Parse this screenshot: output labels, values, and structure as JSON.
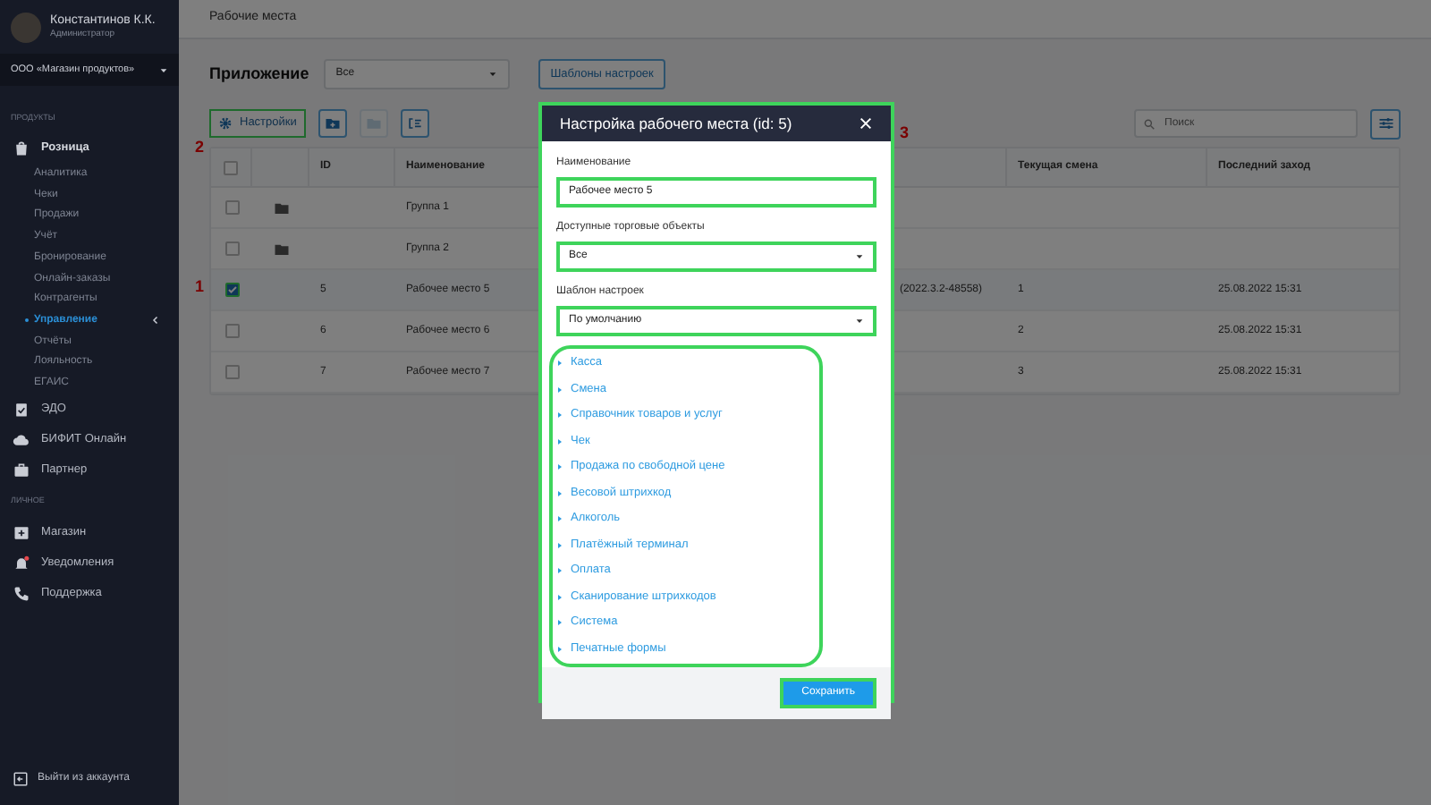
{
  "sidebar": {
    "user": {
      "name": "Константинов К.К.",
      "role": "Администратор"
    },
    "org": "ООО «Магазин продуктов»",
    "sections": [
      {
        "title": "ПРОДУКТЫ",
        "items": [
          {
            "label": "Розница",
            "children": [
              {
                "label": "Аналитика",
                "selected": false
              },
              {
                "label": "Чеки",
                "selected": false
              },
              {
                "label": "Продажи",
                "selected": false
              },
              {
                "label": "Учёт",
                "selected": false
              },
              {
                "label": "Бронирование",
                "selected": false
              },
              {
                "label": "Онлайн-заказы",
                "selected": false
              },
              {
                "label": "Контрагенты",
                "selected": false
              },
              {
                "label": "Управление",
                "selected": true
              },
              {
                "label": "Отчёты",
                "selected": false
              },
              {
                "label": "Лояльность",
                "selected": false
              },
              {
                "label": "ЕГАИС",
                "selected": false
              }
            ]
          },
          {
            "label": "ЭДО"
          },
          {
            "label": "БИФИТ Онлайн"
          },
          {
            "label": "Партнер"
          }
        ]
      },
      {
        "title": "ЛИЧНОЕ",
        "items": [
          {
            "label": "Магазин"
          },
          {
            "label": "Уведомления"
          },
          {
            "label": "Поддержка"
          }
        ]
      }
    ],
    "logout": "Выйти из аккаунта"
  },
  "page_title": "Рабочие места",
  "filter": {
    "label": "Приложение",
    "value": "Все"
  },
  "templates_button": "Шаблоны настроек",
  "toolbar": {
    "settings_button": "Настройки",
    "icon_buttons": [
      {
        "kind": "add-folder",
        "disabled": false
      },
      {
        "kind": "move-folder",
        "disabled": true
      },
      {
        "kind": "list",
        "disabled": false
      }
    ]
  },
  "search": {
    "placeholder": "Поиск"
  },
  "table": {
    "header_checked": false,
    "columns": [
      "ID",
      "Наименование",
      "Текущая смена",
      "Последний заход"
    ],
    "rows": [
      {
        "kind": "group",
        "checked": false,
        "id": "",
        "name": "Группа 1",
        "column_5": "",
        "shift": "",
        "last_login": ""
      },
      {
        "kind": "group",
        "checked": false,
        "id": "",
        "name": "Группа 2",
        "column_5": "",
        "shift": "",
        "last_login": ""
      },
      {
        "kind": "workplace",
        "checked": true,
        "id": "5",
        "name": "Рабочее место 5",
        "column_5": "(2022.3.2-48558)",
        "shift": "1",
        "last_login": "25.08.2022 15:31"
      },
      {
        "kind": "workplace",
        "checked": false,
        "id": "6",
        "name": "Рабочее место 6",
        "column_5": "",
        "shift": "2",
        "last_login": "25.08.2022 15:31"
      },
      {
        "kind": "workplace",
        "checked": false,
        "id": "7",
        "name": "Рабочее место 7",
        "column_5": "",
        "shift": "3",
        "last_login": "25.08.2022 15:31"
      }
    ]
  },
  "annotations": [
    {
      "label": "1"
    },
    {
      "label": "2"
    },
    {
      "label": "3"
    }
  ],
  "dialog": {
    "title": "Настройка рабочего места (id: 5)",
    "fields": [
      {
        "label": "Наименование",
        "kind": "text",
        "value": "Рабочее место 5"
      },
      {
        "label": "Доступные торговые объекты",
        "kind": "select",
        "value": "Все"
      },
      {
        "label": "Шаблон настроек",
        "kind": "select",
        "value": "По умолчанию"
      }
    ],
    "sections": [
      {
        "label": "Касса",
        "expanded": false
      },
      {
        "label": "Смена",
        "expanded": false
      },
      {
        "label": "Справочник товаров и услуг",
        "expanded": false
      },
      {
        "label": "Чек",
        "expanded": false
      },
      {
        "label": "Продажа по свободной цене",
        "expanded": false
      },
      {
        "label": "Весовой штрихкод",
        "expanded": false
      },
      {
        "label": "Алкоголь",
        "expanded": false
      },
      {
        "label": "Платёжный терминал",
        "expanded": false
      },
      {
        "label": "Оплата",
        "expanded": false
      },
      {
        "label": "Сканирование штрихкодов",
        "expanded": false
      },
      {
        "label": "Система",
        "expanded": false
      },
      {
        "label": "Печатные формы",
        "expanded": false
      }
    ],
    "save_button": "Сохранить"
  }
}
